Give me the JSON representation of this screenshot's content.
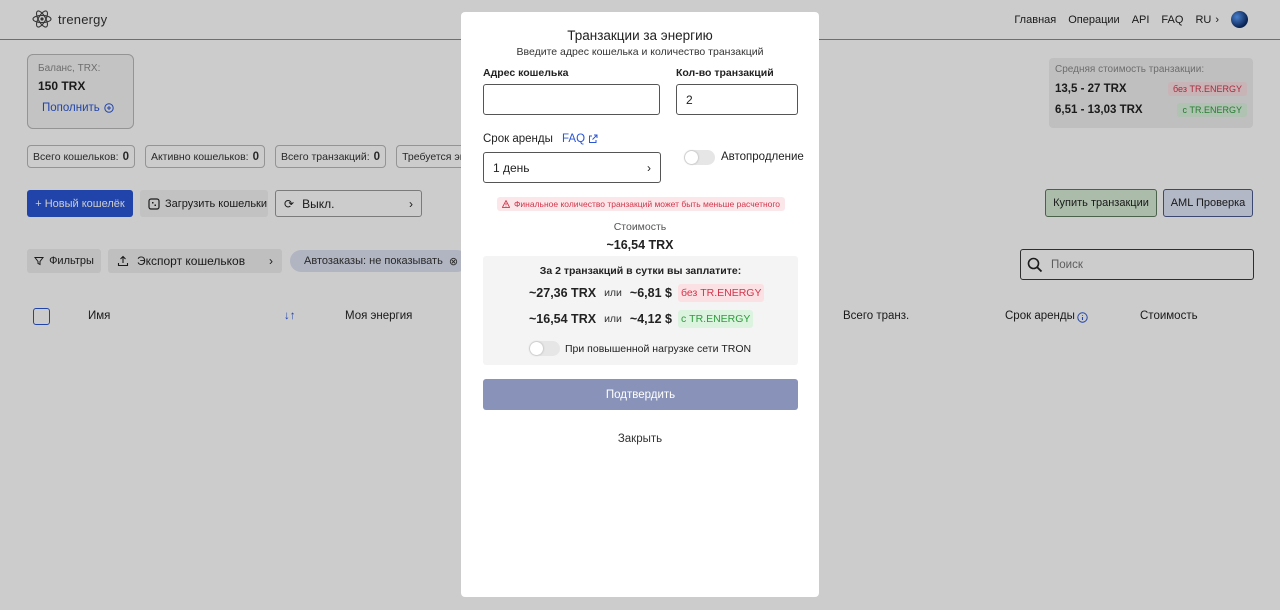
{
  "app": {
    "logo_text": "trenergy"
  },
  "nav": {
    "items": [
      "Главная",
      "Операции",
      "API",
      "FAQ"
    ],
    "lang": "RU"
  },
  "balance": {
    "label": "Баланс, TRX:",
    "value": "150 TRX",
    "topup_label": "Пополнить"
  },
  "avg_cost": {
    "label": "Средняя стоимость транзакции:",
    "rows": [
      {
        "value": "13,5 - 27 TRX",
        "tag": "без TR.ENERGY"
      },
      {
        "value": "6,51 - 13,03 TRX",
        "tag": "с TR.ENERGY"
      }
    ]
  },
  "stats": [
    {
      "label": "Всего кошельков:",
      "value": "0"
    },
    {
      "label": "Активно кошельков:",
      "value": "0"
    },
    {
      "label": "Всего транзакций:",
      "value": "0"
    },
    {
      "label": "Требуется эне",
      "value": ""
    }
  ],
  "actions": {
    "new_wallet": "+ Новый кошелёк",
    "upload_wallets": "Загрузить кошельки",
    "auto_mode": "Выкл.",
    "buy_transactions": "Купить транзакции",
    "aml_check": "AML Проверка"
  },
  "toolbar": {
    "filters": "Фильтры",
    "export": "Экспорт кошельков",
    "autoorders": "Автозаказы: не показывать",
    "search_placeholder": "Поиск"
  },
  "table": {
    "headers": [
      "Имя",
      "Моя энергия",
      "Всего транз.",
      "Срок аренды",
      "Стоимость"
    ]
  },
  "modal": {
    "title": "Транзакции за энергию",
    "subtitle": "Введите адрес кошелька и количество транзакций",
    "wallet_label": "Адрес кошелька",
    "wallet_value": "",
    "count_label": "Кол-во транзакций",
    "count_value": "2",
    "period_label": "Срок аренды",
    "faq_label": "FAQ",
    "period_value": "1 день",
    "autoextend_label": "Автопродление",
    "warning": "Финальное количество транзакций может быть меньше расчетного",
    "cost_label": "Стоимость",
    "cost_value": "~16,54 TRX",
    "panel_title": "За 2 транзакций в сутки вы заплатите:",
    "rows": [
      {
        "trx": "~27,36 TRX",
        "or": "или",
        "usd": "~6,81 $",
        "tag": "без TR.ENERGY"
      },
      {
        "trx": "~16,54 TRX",
        "or": "или",
        "usd": "~4,12 $",
        "tag": "с TR.ENERGY"
      }
    ],
    "load_label": "При повышенной нагрузке сети TRON",
    "confirm_label": "Подтвердить",
    "close_label": "Закрыть"
  }
}
